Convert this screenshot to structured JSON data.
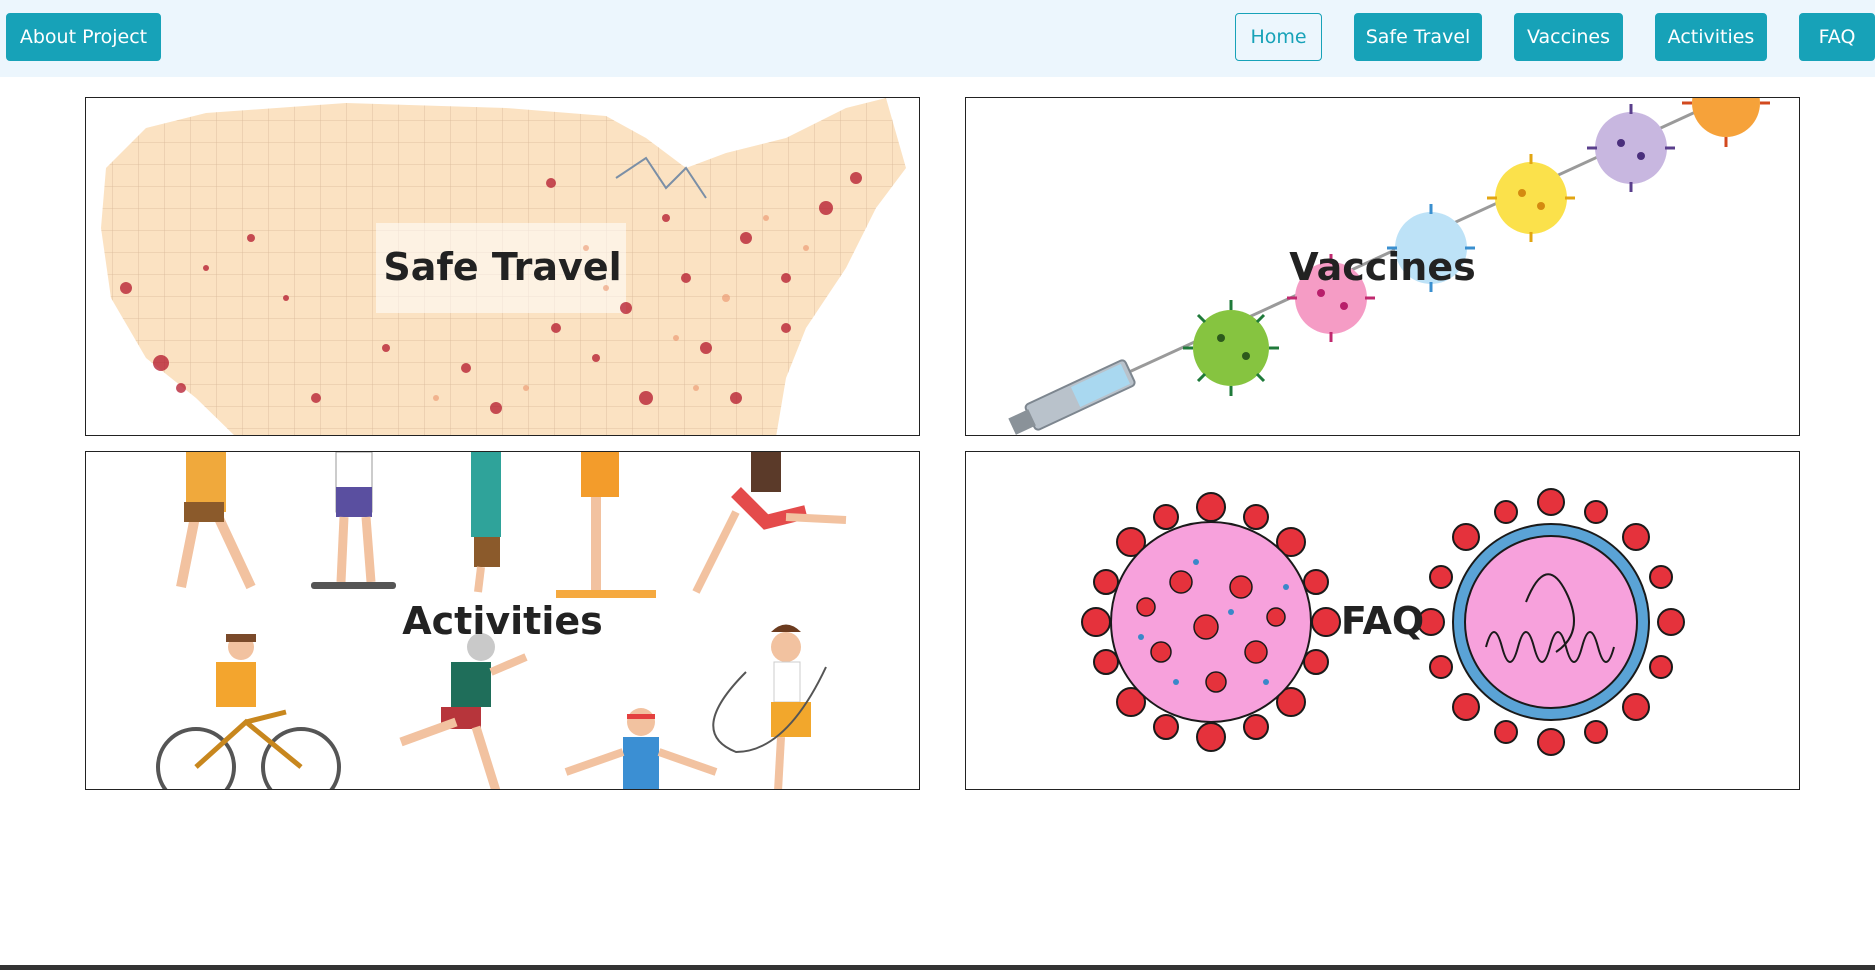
{
  "navbar": {
    "about_label": "About Project",
    "links": {
      "home": "Home",
      "safe_travel": "Safe Travel",
      "vaccines": "Vaccines",
      "activities": "Activities",
      "faq": "FAQ"
    },
    "active": "home",
    "accent_color": "#17a2b8",
    "background_color": "#ecf6fd"
  },
  "cards": {
    "safe_travel": {
      "title": "Safe Travel",
      "image": "us-heat-map-illustration"
    },
    "vaccines": {
      "title": "Vaccines",
      "image": "syringe-and-virus-illustration"
    },
    "activities": {
      "title": "Activities",
      "image": "people-exercising-illustration"
    },
    "faq": {
      "title": "FAQ",
      "image": "coronavirus-illustration"
    }
  }
}
